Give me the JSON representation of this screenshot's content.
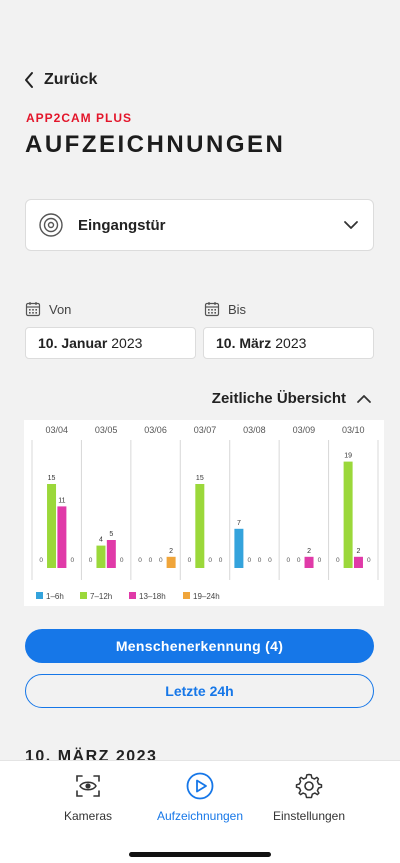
{
  "nav": {
    "back_label": "Zurück"
  },
  "header": {
    "brand": "APP2CAM PLUS",
    "title": "AUFZEICHNUNGEN"
  },
  "camera_select": {
    "value": "Eingangstür",
    "icon": "camera-lens-icon"
  },
  "date_range": {
    "from_label": "Von",
    "from_day": "10. Januar",
    "from_year": "2023",
    "to_label": "Bis",
    "to_day": "10. März",
    "to_year": "2023"
  },
  "overview": {
    "label": "Zeitliche Übersicht"
  },
  "chart_data": {
    "type": "bar",
    "categories": [
      "03/04",
      "03/05",
      "03/06",
      "03/07",
      "03/08",
      "03/09",
      "03/10"
    ],
    "series": [
      {
        "name": "1–6h",
        "color": "#34a3dc",
        "values": [
          0,
          0,
          0,
          0,
          7,
          0,
          0
        ]
      },
      {
        "name": "7–12h",
        "color": "#9bd83a",
        "values": [
          15,
          4,
          0,
          15,
          0,
          0,
          19
        ]
      },
      {
        "name": "13–18h",
        "color": "#e03aa8",
        "values": [
          11,
          5,
          0,
          0,
          0,
          2,
          2
        ]
      },
      {
        "name": "19–24h",
        "color": "#f0a53a",
        "values": [
          0,
          0,
          2,
          0,
          0,
          0,
          0
        ]
      }
    ],
    "ylim": [
      0,
      20
    ],
    "legend": "bottom-left"
  },
  "buttons": {
    "person_detection": "Menschenerkennung (4)",
    "last_24h": "Letzte 24h"
  },
  "section_date": "10. MÄRZ 2023",
  "tabbar": {
    "cameras": "Kameras",
    "recordings": "Aufzeichnungen",
    "settings": "Einstellungen"
  },
  "colors": {
    "accent": "#1677e8",
    "brand": "#e3152a"
  }
}
